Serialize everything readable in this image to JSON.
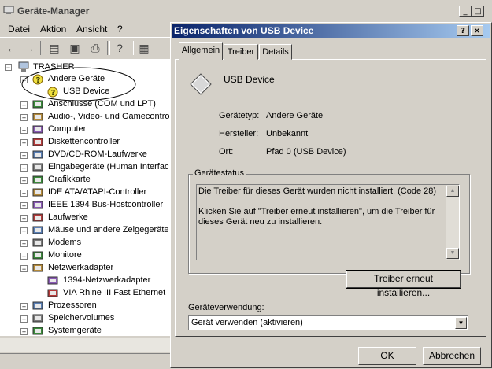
{
  "main_window": {
    "title": "Geräte-Manager",
    "controls": {
      "minimize": "_",
      "maximize": "□",
      "close": "×"
    }
  },
  "menu": [
    "Datei",
    "Aktion",
    "Ansicht",
    "?"
  ],
  "toolbar": {
    "icons": [
      "back-icon",
      "forward-icon",
      "properties-icon",
      "computer-icon",
      "print-icon",
      "help-icon",
      "scan-icon"
    ]
  },
  "tree": {
    "root": "TRASHER",
    "items": [
      {
        "label": "Andere Geräte",
        "icon": "warning-device-icon",
        "expand": "−"
      },
      {
        "label": "USB Device",
        "icon": "warning-device-icon",
        "expand": ""
      },
      {
        "label": "Anschlüsse (COM und LPT)",
        "icon": "port-icon",
        "expand": "+"
      },
      {
        "label": "Audio-, Video- und Gamecontroll",
        "icon": "audio-icon",
        "expand": "+"
      },
      {
        "label": "Computer",
        "icon": "computer-icon",
        "expand": "+"
      },
      {
        "label": "Diskettencontroller",
        "icon": "floppy-icon",
        "expand": "+"
      },
      {
        "label": "DVD/CD-ROM-Laufwerke",
        "icon": "cdrom-icon",
        "expand": "+"
      },
      {
        "label": "Eingabegeräte (Human Interfac",
        "icon": "hid-icon",
        "expand": "+"
      },
      {
        "label": "Grafikkarte",
        "icon": "display-icon",
        "expand": "+"
      },
      {
        "label": "IDE ATA/ATAPI-Controller",
        "icon": "ide-icon",
        "expand": "+"
      },
      {
        "label": "IEEE 1394 Bus-Hostcontroller",
        "icon": "firewire-icon",
        "expand": "+"
      },
      {
        "label": "Laufwerke",
        "icon": "drive-icon",
        "expand": "+"
      },
      {
        "label": "Mäuse und andere Zeigegeräte",
        "icon": "mouse-icon",
        "expand": "+"
      },
      {
        "label": "Modems",
        "icon": "modem-icon",
        "expand": "+"
      },
      {
        "label": "Monitore",
        "icon": "monitor-icon",
        "expand": "+"
      },
      {
        "label": "Netzwerkadapter",
        "icon": "network-icon",
        "expand": "−"
      },
      {
        "label": "1394-Netzwerkadapter",
        "icon": "network-card-icon",
        "expand": ""
      },
      {
        "label": "VIA Rhine III Fast Ethernet",
        "icon": "network-card-icon",
        "expand": ""
      },
      {
        "label": "Prozessoren",
        "icon": "cpu-icon",
        "expand": "+"
      },
      {
        "label": "Speichervolumes",
        "icon": "volume-icon",
        "expand": "+"
      },
      {
        "label": "Systemgeräte",
        "icon": "system-icon",
        "expand": "+"
      }
    ]
  },
  "dialog": {
    "title": "Eigenschaften von USB Device",
    "help_button": "?",
    "close_button": "×",
    "tabs": [
      "Allgemein",
      "Treiber",
      "Details"
    ],
    "device_name": "USB Device",
    "fields": [
      {
        "label": "Gerätetyp:",
        "value": "Andere Geräte"
      },
      {
        "label": "Hersteller:",
        "value": "Unbekannt"
      },
      {
        "label": "Ort:",
        "value": "Pfad 0 (USB Device)"
      }
    ],
    "status_group_label": "Gerätestatus",
    "status_line1": "Die Treiber für dieses Gerät wurden nicht installiert. (Code 28)",
    "status_line2": "Klicken Sie auf \"Treiber erneut installieren\", um die Treiber für dieses Gerät neu zu installieren.",
    "reinstall_button": "Treiber erneut installieren...",
    "usage_label": "Geräteverwendung:",
    "usage_value": "Gerät verwenden (aktivieren)",
    "ok_button": "OK",
    "cancel_button": "Abbrechen"
  },
  "colors": {
    "titlebar_active": "#0a246a",
    "titlebar_gradient_end": "#a6caf0",
    "face": "#d4d0c8"
  }
}
